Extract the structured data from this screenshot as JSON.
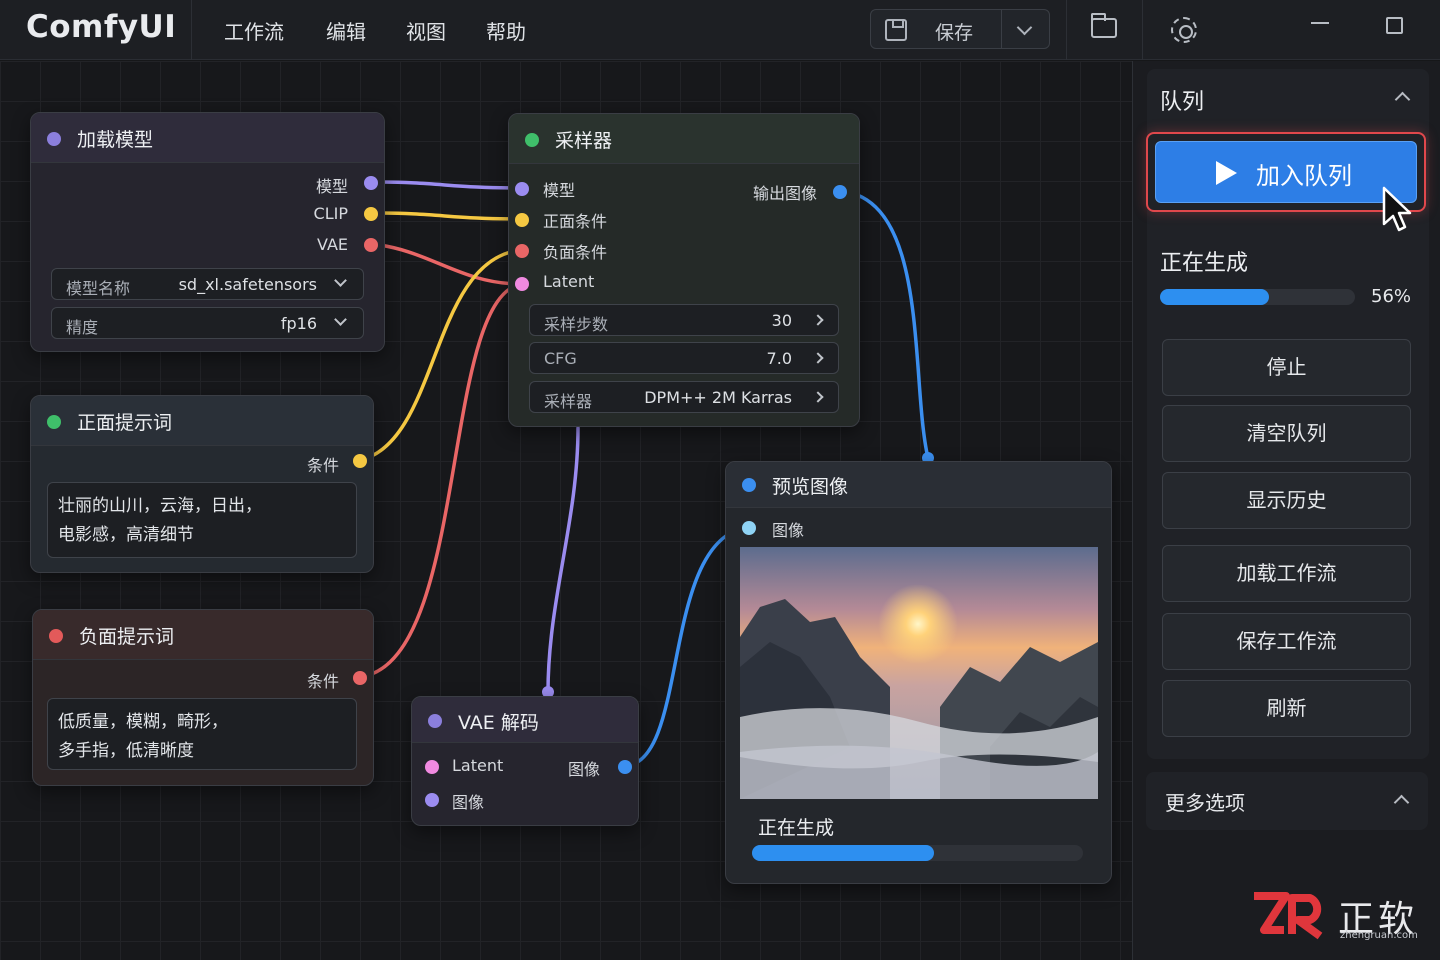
{
  "app": {
    "name": "ComfyUI"
  },
  "menu": [
    "工作流",
    "编辑",
    "视图",
    "帮助"
  ],
  "toolbar": {
    "save_label": "保存"
  },
  "nodes": {
    "load_model": {
      "title": "加载模型",
      "color": "#8b7fdc",
      "outputs": [
        "模型",
        "CLIP",
        "VAE"
      ],
      "fields": [
        {
          "label": "模型名称",
          "value": "sd_xl.safetensors"
        },
        {
          "label": "精度",
          "value": "fp16"
        }
      ]
    },
    "positive": {
      "title": "正面提示词",
      "color": "#3fbf6a",
      "output": "条件",
      "text_line1": "壮丽的山川，云海，日出，",
      "text_line2": "电影感，高清细节"
    },
    "negative": {
      "title": "负面提示词",
      "color": "#e35a5a",
      "output": "条件",
      "text_line1": "低质量，模糊，畸形，",
      "text_line2": "多手指，低清晰度"
    },
    "sampler": {
      "title": "采样器",
      "color": "#3fbf6a",
      "inputs": [
        "模型",
        "正面条件",
        "负面条件",
        "Latent"
      ],
      "output": "输出图像",
      "fields": [
        {
          "label": "采样步数",
          "value": "30"
        },
        {
          "label": "CFG",
          "value": "7.0"
        },
        {
          "label": "采样器",
          "value": "DPM++ 2M Karras"
        }
      ]
    },
    "vae_decode": {
      "title": "VAE 解码",
      "color": "#8b7fdc",
      "inputs": [
        "Latent",
        "图像"
      ],
      "output": "图像"
    },
    "preview": {
      "title": "预览图像",
      "color": "#3b8ff0",
      "input": "图像",
      "status": "正在生成",
      "progress": 0.55
    }
  },
  "sidebar": {
    "queue_title": "队列",
    "queue_button": "加入队列",
    "generating_label": "正在生成",
    "progress_text": "56%",
    "progress": 0.56,
    "buttons": [
      "停止",
      "清空队列",
      "显示历史",
      "加载工作流",
      "保存工作流",
      "刷新"
    ],
    "more_options": "更多选项"
  },
  "watermark": {
    "brand": "正软",
    "url": "zhengruan.com"
  },
  "colors": {
    "model": "#9b8cf0",
    "clip": "#f5c842",
    "vae": "#e96666",
    "latent": "#f08ae0",
    "image": "#3b8ff0",
    "accent": "#2d7ee6"
  }
}
